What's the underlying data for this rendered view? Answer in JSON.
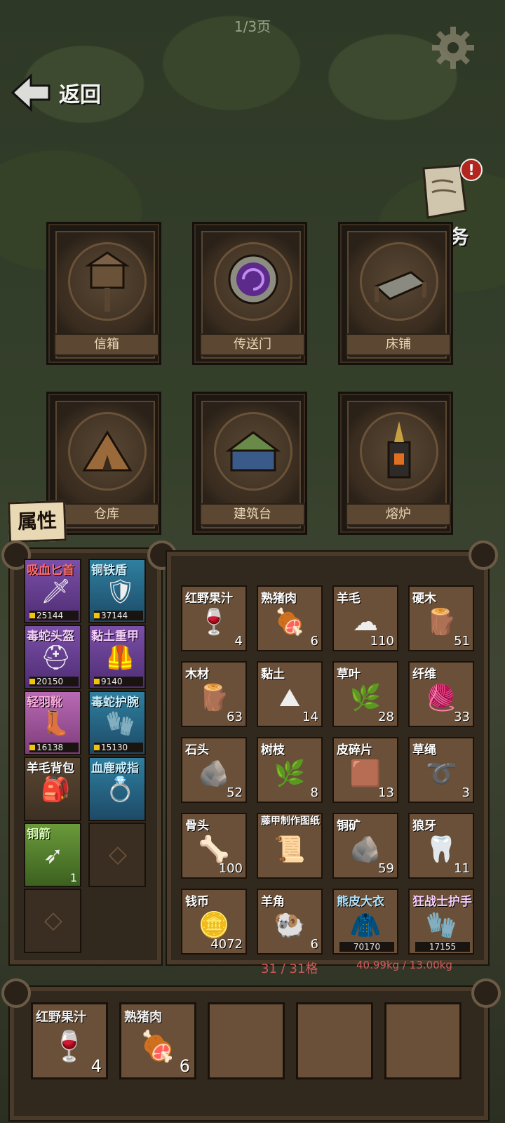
{
  "header": {
    "page_indicator": "1/3页",
    "back_label": "返回",
    "task_label": "任务",
    "task_alert": "!"
  },
  "buildings": [
    {
      "label": "信箱",
      "icon": "mailbox-icon"
    },
    {
      "label": "传送门",
      "icon": "portal-icon"
    },
    {
      "label": "床铺",
      "icon": "bed-icon"
    },
    {
      "label": "仓库",
      "icon": "tent-icon"
    },
    {
      "label": "建筑台",
      "icon": "workbench-icon"
    },
    {
      "label": "熔炉",
      "icon": "furnace-icon"
    }
  ],
  "attributes_button": "属性",
  "equipment": [
    {
      "name": "吸血匕首",
      "value": "25144",
      "rarity": "purple",
      "name_color": "#ff6b6b",
      "icon": "dagger-icon"
    },
    {
      "name": "铜铁盾",
      "value": "37144",
      "rarity": "blue",
      "name_color": "#c8f0ff",
      "icon": "shield-icon"
    },
    {
      "name": "毒蛇头盔",
      "value": "20150",
      "rarity": "purple",
      "name_color": "#f8d0ff",
      "icon": "helmet-icon"
    },
    {
      "name": "黏土重甲",
      "value": "9140",
      "rarity": "purple",
      "name_color": "#f8d0ff",
      "icon": "armor-icon"
    },
    {
      "name": "轻羽靴",
      "value": "16138",
      "rarity": "pink",
      "name_color": "#ffb0e0",
      "icon": "boots-icon"
    },
    {
      "name": "毒蛇护腕",
      "value": "15130",
      "rarity": "blue",
      "name_color": "#c8f0ff",
      "icon": "bracer-icon"
    },
    {
      "name": "羊毛背包",
      "value": "",
      "rarity": "tan",
      "name_color": "#ffffff",
      "icon": "backpack-icon"
    },
    {
      "name": "血鹿戒指",
      "value": "",
      "rarity": "blue",
      "name_color": "#c8f0ff",
      "icon": "ring-icon"
    },
    {
      "name": "铜箭",
      "value": "1",
      "rarity": "green",
      "name_color": "#d8ffb0",
      "icon": "arrow-icon"
    },
    {
      "name": "",
      "value": "",
      "rarity": "dark",
      "name_color": "#ffffff",
      "icon": "empty-slot-icon"
    },
    {
      "name": "",
      "value": "",
      "rarity": "dark",
      "name_color": "#ffffff",
      "icon": "empty-slot-icon"
    }
  ],
  "inventory": [
    {
      "name": "红野果汁",
      "count": "4",
      "icon": "juice-icon",
      "glyph": "🍷"
    },
    {
      "name": "熟猪肉",
      "count": "6",
      "icon": "meat-icon",
      "glyph": "🍖"
    },
    {
      "name": "羊毛",
      "count": "110",
      "icon": "wool-icon",
      "glyph": "☁"
    },
    {
      "name": "硬木",
      "count": "51",
      "icon": "hardwood-icon",
      "glyph": "🪵"
    },
    {
      "name": "木材",
      "count": "63",
      "icon": "wood-icon",
      "glyph": "🪵"
    },
    {
      "name": "黏土",
      "count": "14",
      "icon": "clay-icon",
      "glyph": "⛰"
    },
    {
      "name": "草叶",
      "count": "28",
      "icon": "grass-icon",
      "glyph": "🌿"
    },
    {
      "name": "纤维",
      "count": "33",
      "icon": "fiber-icon",
      "glyph": "🧶"
    },
    {
      "name": "石头",
      "count": "52",
      "icon": "stone-icon",
      "glyph": "🪨"
    },
    {
      "name": "树枝",
      "count": "8",
      "icon": "branch-icon",
      "glyph": "🌿"
    },
    {
      "name": "皮碎片",
      "count": "13",
      "icon": "leather-icon",
      "glyph": "🟫"
    },
    {
      "name": "草绳",
      "count": "3",
      "icon": "rope-icon",
      "glyph": "➰"
    },
    {
      "name": "骨头",
      "count": "100",
      "icon": "bone-icon",
      "glyph": "🦴"
    },
    {
      "name": "藤甲制作图纸",
      "count": "",
      "icon": "blueprint-icon",
      "glyph": "📜"
    },
    {
      "name": "铜矿",
      "count": "59",
      "icon": "copper-ore-icon",
      "glyph": "🪨"
    },
    {
      "name": "狼牙",
      "count": "11",
      "icon": "wolf-fang-icon",
      "glyph": "🦷"
    },
    {
      "name": "钱币",
      "count": "4072",
      "icon": "coin-icon",
      "glyph": "🪙"
    },
    {
      "name": "羊角",
      "count": "6",
      "icon": "ram-horn-icon",
      "glyph": "🐏"
    },
    {
      "name": "熊皮大衣",
      "count": "",
      "bar": "70170",
      "icon": "bear-coat-icon",
      "glyph": "🧥",
      "rarity": "blue"
    },
    {
      "name": "狂战士护手",
      "count": "",
      "bar": "17155",
      "icon": "gauntlet-icon",
      "glyph": "🧤",
      "rarity": "purple"
    }
  ],
  "capacity": "31 / 31格",
  "weight": "40.99kg / 13.00kg",
  "quickbar": [
    {
      "name": "红野果汁",
      "count": "4",
      "icon": "juice-icon",
      "glyph": "🍷"
    },
    {
      "name": "熟猪肉",
      "count": "6",
      "icon": "meat-icon",
      "glyph": "🍖"
    },
    {
      "name": "",
      "count": "",
      "icon": "",
      "glyph": ""
    },
    {
      "name": "",
      "count": "",
      "icon": "",
      "glyph": ""
    },
    {
      "name": "",
      "count": "",
      "icon": "",
      "glyph": ""
    }
  ]
}
